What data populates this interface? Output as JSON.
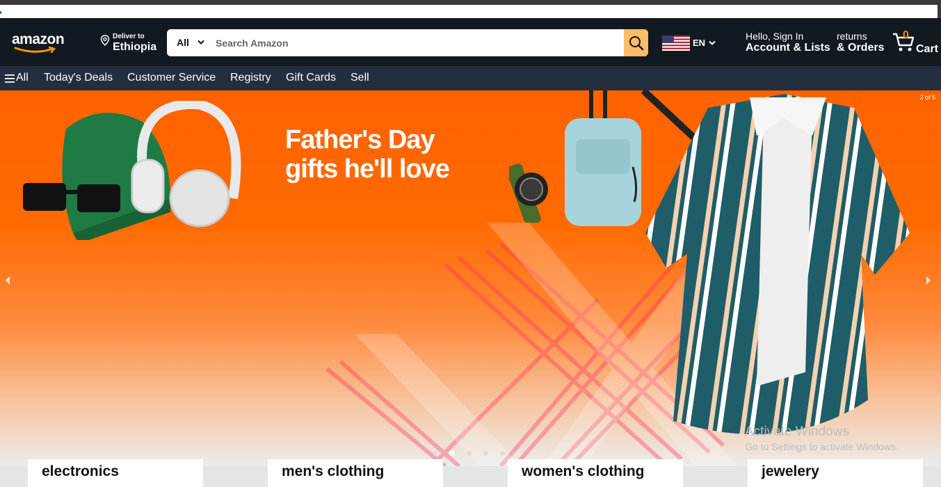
{
  "header": {
    "logo_text": "amazon",
    "deliver_line1": "Deliver to",
    "deliver_line2": "Ethiopia",
    "search_category": "All",
    "search_placeholder": "Search Amazon",
    "language": "EN",
    "account_line1": "Hello, Sign In",
    "account_line2": "Account & Lists",
    "orders_line1": "returns",
    "orders_line2": "& Orders",
    "cart_count": "0",
    "cart_label": "Cart"
  },
  "subnav": {
    "all_label": "All",
    "items": [
      "Today's Deals",
      "Customer Service",
      "Registry",
      "Gift Cards",
      "Sell"
    ]
  },
  "hero": {
    "headline_line1": "Father's Day",
    "headline_line2": "gifts he'll love",
    "slide_counter": "2 of 5",
    "active_slide": 2,
    "total_slides": 5
  },
  "categories": [
    "electronics",
    "men's clothing",
    "women's clothing",
    "jewelery"
  ],
  "watermark": {
    "line1": "Activate Windows",
    "line2": "Go to Settings to activate Windows."
  },
  "colors": {
    "nav_bg": "#131921",
    "subnav_bg": "#232f3e",
    "search_button": "#febd69",
    "hero_orange": "#ff6200",
    "cart_count": "#f08804"
  },
  "icons": [
    "location-pin-icon",
    "chevron-down-icon",
    "search-icon",
    "us-flag-icon",
    "cart-icon",
    "hamburger-icon",
    "chevron-left-icon",
    "chevron-right-icon"
  ]
}
